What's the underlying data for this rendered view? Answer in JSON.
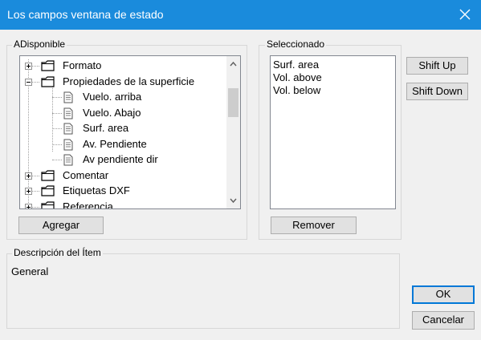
{
  "window": {
    "title": "Los campos ventana de estado"
  },
  "available": {
    "label": "ADisponible",
    "tree": [
      {
        "label": "Formato",
        "type": "folder",
        "expander": "+"
      },
      {
        "label": "Propiedades de la superficie",
        "type": "folder",
        "expander": "-"
      },
      {
        "label": "Vuelo. arriba",
        "type": "document"
      },
      {
        "label": "Vuelo. Abajo",
        "type": "document"
      },
      {
        "label": "Surf. area",
        "type": "document"
      },
      {
        "label": "Av. Pendiente",
        "type": "document"
      },
      {
        "label": "Av pendiente dir",
        "type": "document"
      },
      {
        "label": "Comentar",
        "type": "folder",
        "expander": "+"
      },
      {
        "label": "Etiquetas DXF",
        "type": "folder",
        "expander": "+"
      },
      {
        "label": "Referencia",
        "type": "folder",
        "expander": "+"
      }
    ],
    "add_button": "Agregar"
  },
  "selected": {
    "label": "Seleccionado",
    "items": [
      "Surf. area",
      "Vol. above",
      "Vol. below"
    ],
    "remove_button": "Remover",
    "shift_up_button": "Shift Up",
    "shift_down_button": "Shift Down"
  },
  "description": {
    "label": "Descripción del Ítem",
    "text": "General"
  },
  "buttons": {
    "ok": "OK",
    "cancel": "Cancelar"
  },
  "colors": {
    "titlebar": "#1a8bdc",
    "dialog_bg": "#f0f0f0",
    "default_button_border": "#0078d7"
  }
}
